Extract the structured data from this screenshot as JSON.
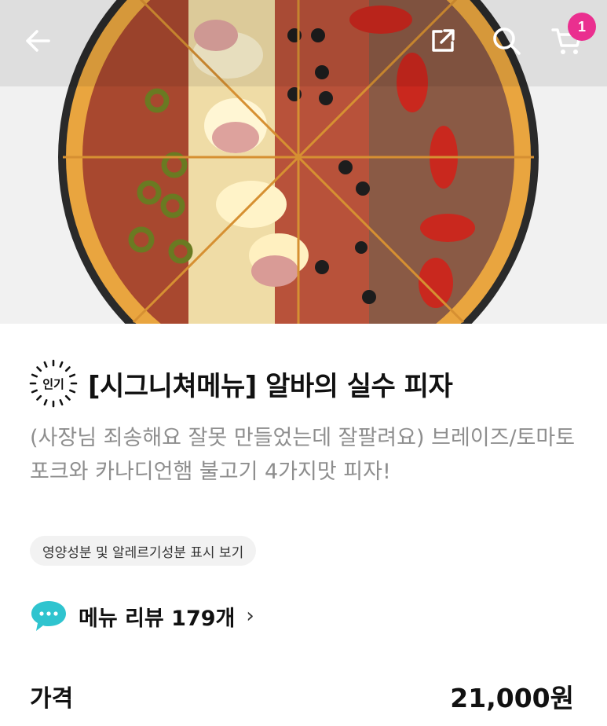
{
  "header": {
    "icons": [
      "back-arrow-icon",
      "share-icon",
      "search-icon",
      "cart-icon"
    ],
    "cart_badge": "1"
  },
  "menu": {
    "badge": "인기",
    "title": "[시그니쳐메뉴] 알바의 실수 피자",
    "description": "(사장님 죄송해요 잘못 만들었는데 잘팔려요) 브레이즈/토마토 포크와 카나디언햄 불고기 4가지맛 피자!",
    "nutrition_link": "영양성분 및 알레르기성분 표시 보기",
    "review_label": "메뉴 리뷰 179개",
    "review_chevron": "›",
    "price_label": "가격",
    "price_value": "21,000원"
  },
  "colors": {
    "badge_pink": "#ea2f8f",
    "review_icon": "#2fc4cf",
    "description_gray": "#8e8e8e",
    "chip_bg": "#f2f2f2"
  }
}
